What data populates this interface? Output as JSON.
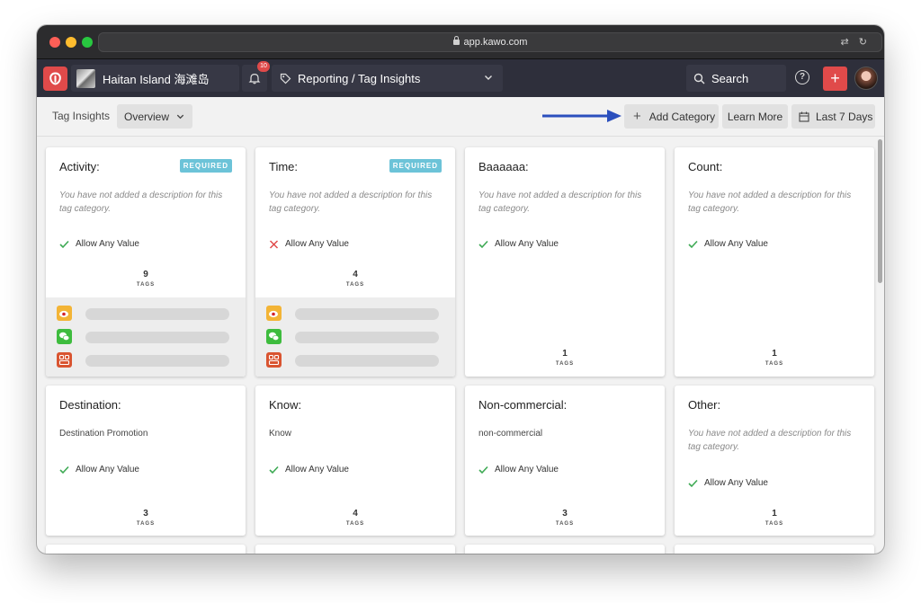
{
  "browser": {
    "url": "app.kawo.com"
  },
  "header": {
    "org_name": "Haitan Island 海滩岛",
    "notifications_count": "10",
    "breadcrumb": "Reporting / Tag Insights",
    "search_label": "Search",
    "help_label": "?",
    "plus_label": "+"
  },
  "subheader": {
    "title": "Tag Insights",
    "view_select": "Overview",
    "add_category": "Add Category",
    "learn_more": "Learn More",
    "date_range": "Last 7 Days"
  },
  "tags_label": "TAGS",
  "required_label": "REQUIRED",
  "allow_any_value_label": "Allow Any Value",
  "cards": [
    {
      "title": "Activity:",
      "description": "You have not added a description for this tag category.",
      "count": "9"
    },
    {
      "title": "Time:",
      "description": "You have not added a description for this tag category.",
      "count": "4"
    },
    {
      "title": "Baaaaaa:",
      "description": "You have not added a description for this tag category.",
      "count": "1"
    },
    {
      "title": "Count:",
      "description": "You have not added a description for this tag category.",
      "count": "1"
    },
    {
      "title": "Destination:",
      "description": "Destination Promotion",
      "count": "3"
    },
    {
      "title": "Know:",
      "description": "Know",
      "count": "4"
    },
    {
      "title": "Non-commercial:",
      "description": "non-commercial",
      "count": "3"
    },
    {
      "title": "Other:",
      "description": "You have not added a description for this tag category.",
      "count": "1"
    }
  ],
  "icons": {
    "allow_check": "check-icon",
    "disallow": "x-icon",
    "social": [
      "weibo-icon",
      "wechat-icon",
      "xiaohongshu-icon"
    ]
  },
  "colors": {
    "accent": "#e04a4a",
    "header_bg": "#2e2f3b",
    "required_badge": "#6cc3d8",
    "check_green": "#3eaa54",
    "x_red": "#e04a4a",
    "annotation_arrow": "#2b4fbd"
  }
}
